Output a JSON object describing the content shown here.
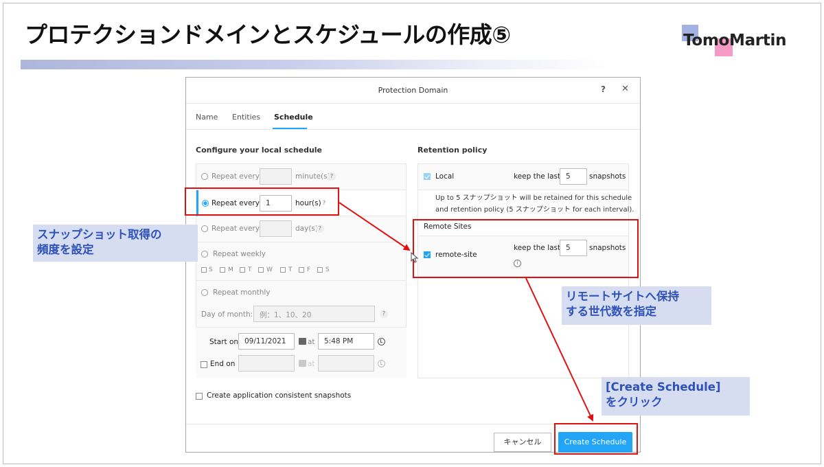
{
  "slide": {
    "title": "プロテクションドメインとスケジュールの作成⑤",
    "logo_text": "TomoMartin",
    "accent_color": "#2e52b8",
    "annotation_color": "#e01010"
  },
  "dialog": {
    "title": "Protection Domain",
    "help_label": "?",
    "close_label": "✕",
    "tabs": [
      {
        "label": "Name"
      },
      {
        "label": "Entities"
      },
      {
        "label": "Schedule",
        "active": true
      }
    ],
    "local_schedule": {
      "heading": "Configure your local schedule",
      "minutes": {
        "label": "Repeat every",
        "value": "",
        "unit": "minute(s)"
      },
      "hours": {
        "label": "Repeat every",
        "value": "1",
        "unit": "hour(s)",
        "selected": true
      },
      "days": {
        "label": "Repeat every",
        "value": "",
        "unit": "day(s)"
      },
      "weekly": {
        "label": "Repeat weekly",
        "days": [
          "S",
          "M",
          "T",
          "W",
          "T",
          "F",
          "S"
        ]
      },
      "monthly": {
        "label": "Repeat monthly",
        "day_of_month_label": "Day of month:",
        "day_of_month_placeholder": "例：1、10、20"
      },
      "start": {
        "label": "Start on",
        "date": "09/11/2021",
        "at": "at",
        "time": "5:48 PM"
      },
      "end": {
        "label": "End on",
        "at": "at"
      },
      "help_mark": "?"
    },
    "app_consistent_label": "Create application consistent snapshots",
    "retention": {
      "heading": "Retention policy",
      "local": {
        "label": "Local",
        "keep_label": "keep the last",
        "value": "5",
        "unit": "snapshots",
        "checked": true
      },
      "note_line1": "Up to 5 スナップショット will be retained for this schedule",
      "note_line2": "and retention policy (5 スナップショット for each interval).",
      "remote_heading": "Remote Sites",
      "remote": {
        "label": "remote-site",
        "keep_label": "keep the last",
        "value": "5",
        "unit": "snapshots",
        "checked": true
      },
      "info_mark": "i"
    },
    "footer": {
      "cancel_label": "キャンセル",
      "create_label": "Create Schedule",
      "create_color": "#22a5f7"
    }
  },
  "annotations": {
    "callout_frequency": [
      "スナップショット取得の",
      "頻度を設定"
    ],
    "callout_remote": [
      "リモートサイトへ保持",
      "する世代数を指定"
    ],
    "callout_create": [
      "[Create Schedule]",
      "をクリック"
    ]
  }
}
